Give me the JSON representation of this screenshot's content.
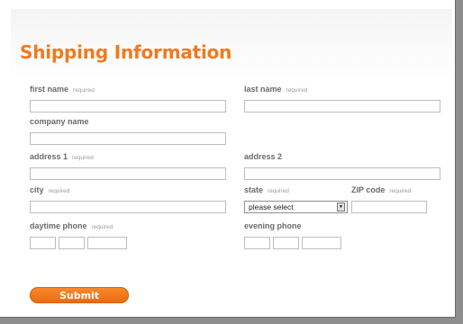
{
  "form": {
    "title": "Shipping Information",
    "required_tag": "required",
    "first_name": {
      "label": "first name",
      "value": ""
    },
    "last_name": {
      "label": "last name",
      "value": ""
    },
    "company_name": {
      "label": "company name",
      "value": ""
    },
    "address1": {
      "label": "address 1",
      "value": ""
    },
    "address2": {
      "label": "address 2",
      "value": ""
    },
    "city": {
      "label": "city",
      "value": ""
    },
    "state": {
      "label": "state",
      "selected": "please select",
      "arrow": "▼"
    },
    "zip": {
      "label": "ZIP code",
      "value": ""
    },
    "daytime_phone": {
      "label": "daytime phone"
    },
    "evening_phone": {
      "label": "evening phone"
    },
    "submit_label": "Submit"
  },
  "colors": {
    "accent": "#f17a1f",
    "label": "#6b6b6b",
    "border": "#bdbdbd"
  }
}
